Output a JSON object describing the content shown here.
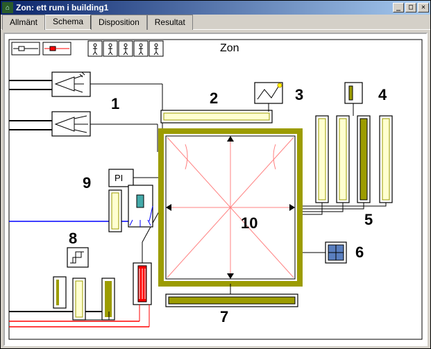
{
  "window": {
    "title": "Zon: ett rum i building1"
  },
  "tabs": [
    {
      "label": "Allmänt",
      "active": false
    },
    {
      "label": "Schema",
      "active": true
    },
    {
      "label": "Disposition",
      "active": false
    },
    {
      "label": "Resultat",
      "active": false
    }
  ],
  "schema": {
    "title": "Zon",
    "labels": {
      "n1": "1",
      "n2": "2",
      "n3": "3",
      "n4": "4",
      "n5": "5",
      "n6": "6",
      "n7": "7",
      "n8": "8",
      "n9": "9",
      "n10": "10",
      "pi": "PI"
    },
    "toolbar_icons": [
      "connector-white",
      "connector-red",
      "person-up",
      "person-down",
      "person-right",
      "person-left",
      "person-generic"
    ]
  },
  "colors": {
    "olive": "#9c9c00",
    "red": "#ff0000",
    "blue": "#0000ff",
    "pink": "#ff8080",
    "lightyellow": "#ffffd0"
  }
}
